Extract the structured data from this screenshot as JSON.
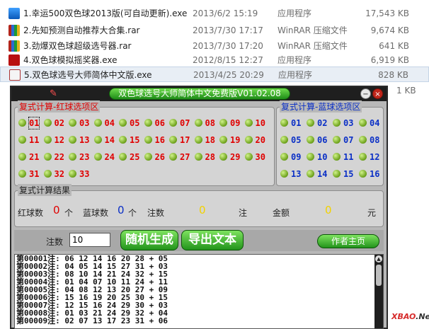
{
  "files": [
    {
      "name": "1.幸运500双色球2013版(可自动更新).exe",
      "date": "2013/6/2 15:19",
      "type": "应用程序",
      "size": "17,543 KB",
      "icon": "app-icon"
    },
    {
      "name": "2.先知预测自动推荐大合集.rar",
      "date": "2013/7/30 17:17",
      "type": "WinRAR 压缩文件",
      "size": "9,674 KB",
      "icon": "winrar-icon"
    },
    {
      "name": "3.劲爆双色球超级选号器.rar",
      "date": "2013/7/30 17:20",
      "type": "WinRAR 压缩文件",
      "size": "641 KB",
      "icon": "winrar-icon"
    },
    {
      "name": "4.双色球模拟摇奖器.exe",
      "date": "2012/8/15 12:27",
      "type": "应用程序",
      "size": "6,919 KB",
      "icon": "flash-icon"
    },
    {
      "name": "5.双色球选号大师简体中文版.exe",
      "date": "2013/4/25 20:29",
      "type": "应用程序",
      "size": "828 KB",
      "icon": "app-icon"
    }
  ],
  "behind_size": "1 KB",
  "app": {
    "title": "双色球选号大师简体中文免费版V01.02.08",
    "minimize_glyph": "−",
    "close_glyph": "×",
    "red_group_title": "复式计算-红球选项区",
    "blue_group_title": "复式计算-蓝球选项区",
    "red_balls": [
      "01",
      "02",
      "03",
      "04",
      "05",
      "06",
      "07",
      "08",
      "09",
      "10",
      "11",
      "12",
      "13",
      "14",
      "15",
      "16",
      "17",
      "18",
      "19",
      "20",
      "21",
      "22",
      "23",
      "24",
      "25",
      "26",
      "27",
      "28",
      "29",
      "30",
      "31",
      "32",
      "33"
    ],
    "blue_balls": [
      "01",
      "02",
      "03",
      "04",
      "05",
      "06",
      "07",
      "08",
      "09",
      "10",
      "11",
      "12",
      "13",
      "14",
      "15",
      "16"
    ],
    "result_title": "复式计算结果",
    "red_count_label": "红球数",
    "red_count": "0",
    "unit_ge": "个",
    "blue_count_label": "蓝球数",
    "blue_count": "0",
    "unit_ge2": "个",
    "bets_label": "注数",
    "bets_value": "0",
    "unit_zhu": "注",
    "amount_label": "金额",
    "amount_value": "0",
    "unit_yuan": "元",
    "count_label": "注数",
    "count_value": "10",
    "random_button": "随机生成",
    "export_button": "导出文本",
    "author_button": "作者主页",
    "output_lines": [
      "第00001注: 06 12 14 16 20 28 + 05",
      "第00002注: 04 05 14 15 27 31 + 03",
      "第00003注: 08 10 14 21 24 32 + 15",
      "第00004注: 01 04 07 10 11 24 + 11",
      "第00005注: 04 08 12 13 20 27 + 09",
      "第00006注: 15 16 19 20 25 30 + 15",
      "第00007注: 12 15 16 24 29 30 + 03",
      "第00008注: 01 03 21 24 29 32 + 04",
      "第00009注: 02 07 13 17 23 31 + 06"
    ],
    "colors": {
      "red_number": "#e00000",
      "blue_number": "#0a2fc6",
      "value_yellow": "#f2d200",
      "button_green": "#22941b"
    }
  },
  "watermark": {
    "prefix": "XBAO",
    "suffix": "Net"
  }
}
